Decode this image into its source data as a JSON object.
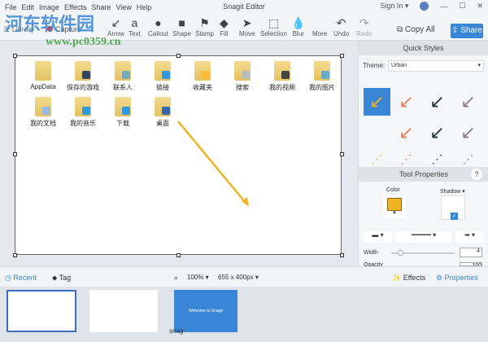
{
  "menu": [
    "File",
    "Edit",
    "Image",
    "Effects",
    "Share",
    "View",
    "Help"
  ],
  "window": {
    "title": "Snagit Editor",
    "sign_in": "Sign In ▾",
    "minimize": "—",
    "maximize": "☐",
    "close": "✕"
  },
  "toolbar": {
    "library": "Library",
    "capture": "Capture",
    "tools": [
      {
        "label": "Arrow",
        "icon": "↙"
      },
      {
        "label": "Text",
        "icon": "a"
      },
      {
        "label": "Callout",
        "icon": "●"
      },
      {
        "label": "Shape",
        "icon": "■"
      },
      {
        "label": "Stamp",
        "icon": "⚑"
      },
      {
        "label": "Fill",
        "icon": "◆"
      },
      {
        "label": "Move",
        "icon": "➤"
      },
      {
        "label": "Selection",
        "icon": "⬚"
      },
      {
        "label": "Blur",
        "icon": "💧"
      },
      {
        "label": "More",
        "icon": ""
      },
      {
        "label": "Undo",
        "icon": "↶"
      },
      {
        "label": "Redo",
        "icon": "↷"
      }
    ],
    "copy_all": "Copy All",
    "share": "Share"
  },
  "watermark": {
    "text": "河东软件园",
    "url": "www.pc0359.cn"
  },
  "canvas": {
    "folders": [
      {
        "label": "AppData"
      },
      {
        "label": "保存的游戏"
      },
      {
        "label": "联系人"
      },
      {
        "label": "链接"
      },
      {
        "label": "收藏夹"
      },
      {
        "label": "搜索"
      },
      {
        "label": "我的视频"
      },
      {
        "label": "我的图片"
      },
      {
        "label": "我的文档"
      },
      {
        "label": "我的音乐"
      },
      {
        "label": "下载"
      },
      {
        "label": "桌面"
      }
    ]
  },
  "panel": {
    "quick_styles": "Quick Styles",
    "theme_label": "Theme:",
    "theme_value": "Urban",
    "tool_properties": "Tool Properties",
    "help": "?",
    "color_label": "Color",
    "color_value": "#f0b323",
    "shadow_label": "Shadow ▾",
    "width_label": "Width",
    "width_value": "4",
    "opacity_label": "Opacity",
    "opacity_value": "100",
    "width_fraction": 0.1
  },
  "bottom": {
    "recent": "Recent",
    "tag": "Tag",
    "zoom": "100% ▾",
    "size": "655 x 400px ▾",
    "effects": "Effects",
    "properties": "Properties"
  },
  "tray": {
    "welcome": "Welcome to Snagit",
    "snag_label": "snag"
  },
  "colors": {
    "accent": "#3a86d6",
    "arrow": "#f0b323"
  }
}
